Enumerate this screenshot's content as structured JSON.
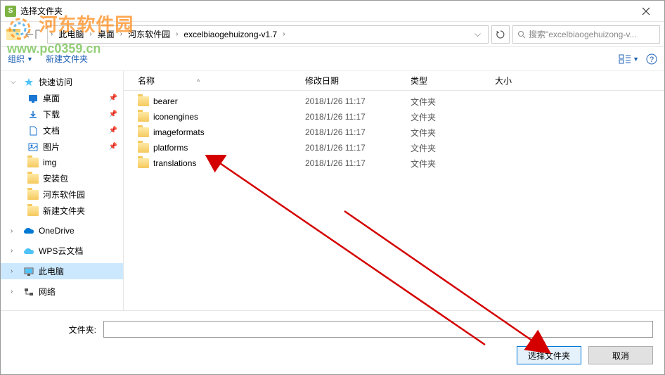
{
  "window": {
    "title": "选择文件夹"
  },
  "breadcrumb": {
    "seg1": "此电脑",
    "seg2": "桌面",
    "seg3": "河东软件园",
    "seg4": "excelbiaogehuizong-v1.7"
  },
  "search": {
    "placeholder": "搜索\"excelbiaogehuizong-v..."
  },
  "toolbar": {
    "organize": "组织",
    "newfolder": "新建文件夹"
  },
  "columns": {
    "name": "名称",
    "date": "修改日期",
    "type": "类型",
    "size": "大小"
  },
  "sidebar": {
    "quick": "快速访问",
    "desktop": "桌面",
    "downloads": "下载",
    "documents": "文档",
    "pictures": "图片",
    "img": "img",
    "pkg": "安装包",
    "hd": "河东软件园",
    "newf": "新建文件夹",
    "onedrive": "OneDrive",
    "wps": "WPS云文档",
    "thispc": "此电脑",
    "network": "网络"
  },
  "files": [
    {
      "name": "bearer",
      "date": "2018/1/26 11:17",
      "type": "文件夹"
    },
    {
      "name": "iconengines",
      "date": "2018/1/26 11:17",
      "type": "文件夹"
    },
    {
      "name": "imageformats",
      "date": "2018/1/26 11:17",
      "type": "文件夹"
    },
    {
      "name": "platforms",
      "date": "2018/1/26 11:17",
      "type": "文件夹"
    },
    {
      "name": "translations",
      "date": "2018/1/26 11:17",
      "type": "文件夹"
    }
  ],
  "bottom": {
    "folder_label": "文件夹:",
    "select": "选择文件夹",
    "cancel": "取消"
  },
  "watermark": {
    "title": "河东软件园",
    "url": "www.pc0359.cn"
  }
}
